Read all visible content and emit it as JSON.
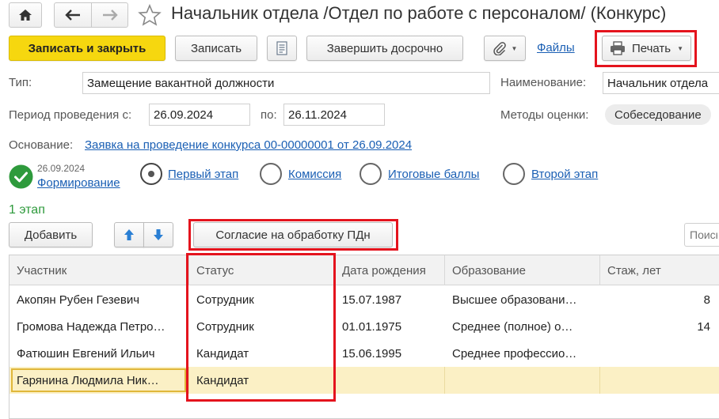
{
  "window": {
    "title": "Начальник отдела /Отдел по работе с персоналом/ (Конкурс)"
  },
  "toolbar": {
    "save_close": "Записать и закрыть",
    "save": "Записать",
    "finish_early": "Завершить досрочно",
    "files": "Файлы",
    "print": "Печать"
  },
  "form": {
    "type_label": "Тип:",
    "type_value": "Замещение вакантной должности",
    "name_label": "Наименование:",
    "name_value": "Начальник отдела",
    "period_label": "Период проведения с:",
    "period_from": "26.09.2024",
    "period_to_label": "по:",
    "period_to": "26.11.2024",
    "methods_label": "Методы оценки:",
    "methods_value": "Собеседование",
    "basis_label": "Основание:",
    "basis_link": "Заявка на проведение конкурса 00-00000001 от 26.09.2024"
  },
  "stages": {
    "done_date": "26.09.2024",
    "done_label": "Формирование",
    "items": [
      {
        "label": "Первый этап"
      },
      {
        "label": "Комиссия"
      },
      {
        "label": "Итоговые баллы"
      },
      {
        "label": "Второй этап"
      }
    ]
  },
  "section": {
    "title": "1 этап",
    "add_button": "Добавить",
    "consent_button": "Согласие на обработку ПДн",
    "search_placeholder": "Поиск"
  },
  "table": {
    "columns": [
      "Участник",
      "Статус",
      "Дата рождения",
      "Образование",
      "Стаж, лет"
    ],
    "rows": [
      {
        "name": "Акопян Рубен Гезевич",
        "status": "Сотрудник",
        "birth": "15.07.1987",
        "education": "Высшее образовани…",
        "exp": "8"
      },
      {
        "name": "Громова Надежда Петро…",
        "status": "Сотрудник",
        "birth": "01.01.1975",
        "education": "Среднее (полное) о…",
        "exp": "14"
      },
      {
        "name": "Фатюшин Евгений Ильич",
        "status": "Кандидат",
        "birth": "15.06.1995",
        "education": "Среднее профессио…",
        "exp": ""
      },
      {
        "name": "Гарянина Людмила Ник…",
        "status": "Кандидат",
        "birth": "",
        "education": "",
        "exp": ""
      }
    ]
  },
  "colors": {
    "accent_yellow": "#f6d70f",
    "link_blue": "#1a5fb4",
    "highlight_red": "#e4131d",
    "done_green": "#2e9a3c",
    "selected_row": "#fbf0c5"
  }
}
